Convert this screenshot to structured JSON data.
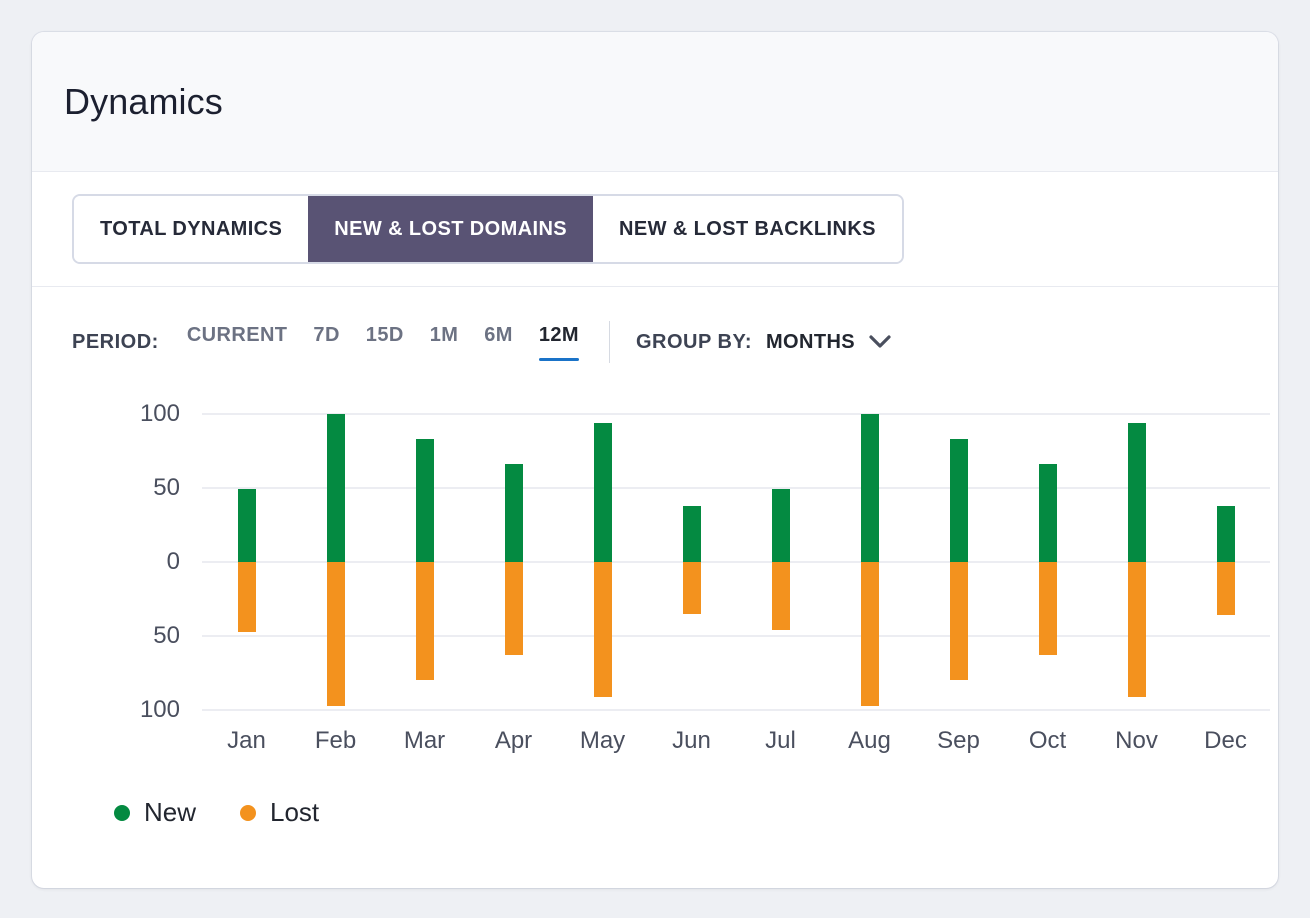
{
  "header": {
    "title": "Dynamics"
  },
  "tabs": [
    {
      "label": "TOTAL DYNAMICS",
      "active": false
    },
    {
      "label": "NEW & LOST DOMAINS",
      "active": true
    },
    {
      "label": "NEW & LOST BACKLINKS",
      "active": false
    }
  ],
  "controls": {
    "period_label": "PERIOD:",
    "period_options": [
      {
        "label": "CURRENT",
        "active": false
      },
      {
        "label": "7D",
        "active": false
      },
      {
        "label": "15D",
        "active": false
      },
      {
        "label": "1M",
        "active": false
      },
      {
        "label": "6M",
        "active": false
      },
      {
        "label": "12M",
        "active": true
      }
    ],
    "groupby_label": "GROUP BY:",
    "groupby_value": "MONTHS",
    "groupby_icon": "chevron-down-icon",
    "active_underline_color": "#1a73c8"
  },
  "chart_data": {
    "type": "bar",
    "title": "",
    "xlabel": "",
    "ylabel": "",
    "categories": [
      "Jan",
      "Feb",
      "Mar",
      "Apr",
      "May",
      "Jun",
      "Jul",
      "Aug",
      "Sep",
      "Oct",
      "Nov",
      "Dec"
    ],
    "series": [
      {
        "name": "New",
        "color": "#048a41",
        "values": [
          49,
          100,
          83,
          66,
          94,
          38,
          49,
          100,
          83,
          66,
          94,
          38
        ]
      },
      {
        "name": "Lost",
        "color": "#f3921e",
        "values": [
          -47,
          -97,
          -80,
          -63,
          -91,
          -35,
          -46,
          -97,
          -80,
          -63,
          -91,
          -36
        ]
      }
    ],
    "ylim": [
      -100,
      100
    ],
    "yticks": [
      100,
      50,
      0,
      50,
      100
    ],
    "ytick_values": [
      100,
      50,
      0,
      -50,
      -100
    ],
    "grid": true,
    "legend_position": "bottom-left",
    "stacked_diverging": true
  },
  "legend": [
    {
      "label": "New",
      "color": "#048a41",
      "icon": "legend-dot-new"
    },
    {
      "label": "Lost",
      "color": "#f3921e",
      "icon": "legend-dot-lost"
    }
  ]
}
